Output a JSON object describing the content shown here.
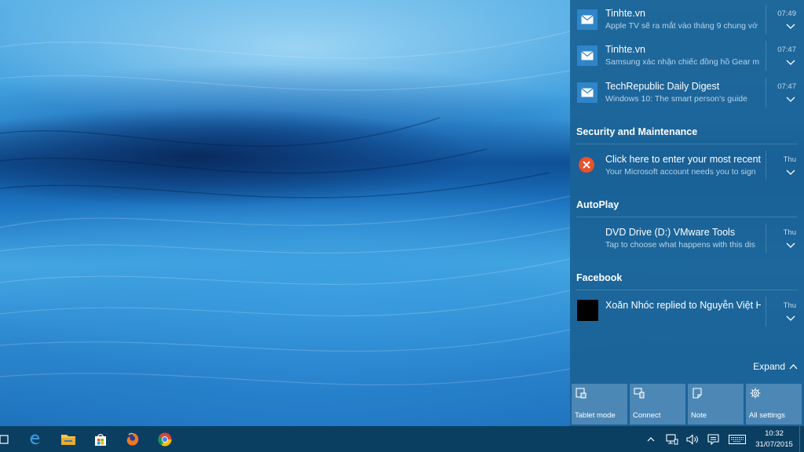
{
  "notifications_top": [
    {
      "app": "Tinhte.vn",
      "body": "Apple TV sẽ ra mắt vào tháng 9 chung vớ",
      "time": "07:49",
      "icon": "mail-icon"
    },
    {
      "app": "Tinhte.vn",
      "body": "Samsung xác nhận chiếc đồng hồ Gear m",
      "time": "07:47",
      "icon": "mail-icon"
    },
    {
      "app": "TechRepublic Daily Digest",
      "body": "Windows 10: The smart person's guide",
      "time": "07:47",
      "icon": "mail-icon"
    }
  ],
  "groups": [
    {
      "header": "Security and Maintenance",
      "title": "Click here to enter your most recent",
      "body": "Your Microsoft account needs you to sign",
      "time": "Thu",
      "icon": "error-icon"
    },
    {
      "header": "AutoPlay",
      "title": "DVD Drive (D:) VMware Tools",
      "body": "Tap to choose what happens with this dis",
      "time": "Thu",
      "icon": "none"
    },
    {
      "header": "Facebook",
      "title": "Xoăn Nhóc replied to Nguyễn Việt H",
      "body": "",
      "time": "Thu",
      "icon": "avatar"
    }
  ],
  "expand_label": "Expand",
  "quick_actions": [
    {
      "label": "Tablet mode",
      "icon": "tablet-mode-icon"
    },
    {
      "label": "Connect",
      "icon": "connect-icon"
    },
    {
      "label": "Note",
      "icon": "note-icon"
    },
    {
      "label": "All settings",
      "icon": "settings-icon"
    }
  ],
  "taskbar": {
    "apps": [
      "task-view-icon",
      "edge-icon",
      "file-explorer-icon",
      "store-icon",
      "firefox-icon",
      "chrome-icon"
    ],
    "clock_time": "10:32",
    "clock_date": "31/07/2015"
  },
  "colors": {
    "accent": "#1a6296",
    "taskbar": "#0b3f62",
    "error": "#e8522c"
  }
}
